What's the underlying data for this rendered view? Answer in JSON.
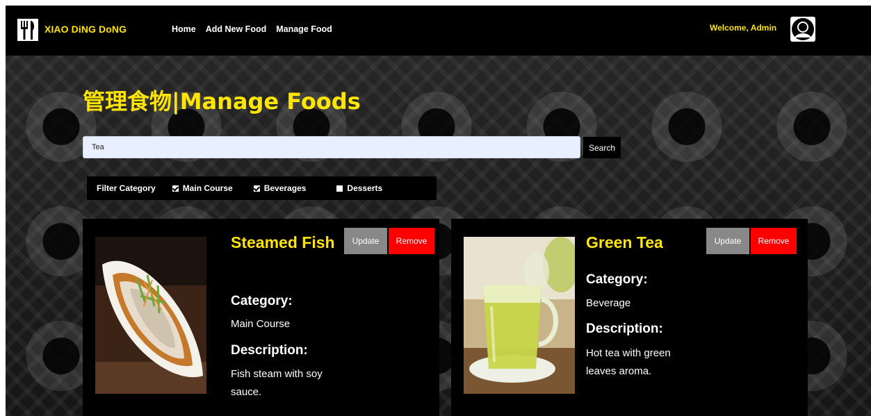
{
  "nav": {
    "brand": "XIAO DiNG DoNG",
    "links": [
      "Home",
      "Add New Food",
      "Manage Food"
    ],
    "welcome": "Welcome, Admin",
    "logo_icon": "fork-knife-icon",
    "avatar_icon": "user-avatar-icon"
  },
  "page": {
    "title": "管理食物|Manage Foods"
  },
  "search": {
    "value": "Tea",
    "button_label": "Search"
  },
  "filter": {
    "label": "Filter Category",
    "options": [
      {
        "label": "Main Course",
        "checked": true
      },
      {
        "label": "Beverages",
        "checked": true
      },
      {
        "label": "Desserts",
        "checked": false
      }
    ]
  },
  "foods": [
    {
      "name": "Steamed Fish",
      "category_label": "Category:",
      "category": "Main Course",
      "description_label": "Description:",
      "description": "Fish steam with soy sauce.",
      "update_label": "Update",
      "remove_label": "Remove"
    },
    {
      "name": "Green Tea",
      "category_label": "Category:",
      "category": "Beverage",
      "description_label": "Description:",
      "description": "Hot tea with green leaves aroma.",
      "update_label": "Update",
      "remove_label": "Remove"
    }
  ],
  "colors": {
    "accent": "#ffe500",
    "remove": "#ff0000",
    "update": "#888888",
    "search_bg": "#e8efff"
  }
}
